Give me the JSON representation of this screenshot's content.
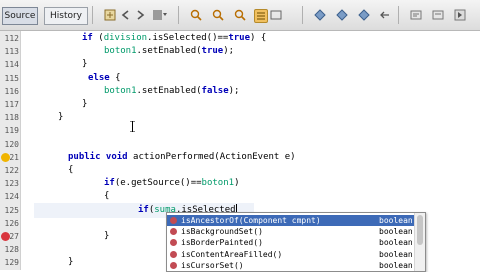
{
  "toolbar": {
    "tab_source": "Source",
    "tab_history": "History"
  },
  "editor": {
    "lines": [
      {
        "num": "112",
        "parts": [
          [
            "kw",
            "if"
          ],
          [
            "t",
            " ("
          ],
          [
            "cls",
            "division"
          ],
          [
            "t",
            ".isSelected()=="
          ],
          [
            "lit",
            "true"
          ],
          [
            "t",
            ") {"
          ]
        ],
        "indent": 82
      },
      {
        "num": "113",
        "parts": [
          [
            "cls",
            "boton1"
          ],
          [
            "t",
            ".setEnabled("
          ],
          [
            "lit",
            "true"
          ],
          [
            "t",
            ");"
          ]
        ],
        "indent": 104
      },
      {
        "num": "114",
        "parts": [
          [
            "t",
            "}"
          ]
        ],
        "indent": 82
      },
      {
        "num": "115",
        "parts": [
          [
            "kw",
            "else"
          ],
          [
            "t",
            " {"
          ]
        ],
        "indent": 88
      },
      {
        "num": "116",
        "parts": [
          [
            "cls",
            "boton1"
          ],
          [
            "t",
            ".setEnabled("
          ],
          [
            "lit",
            "false"
          ],
          [
            "t",
            ");"
          ]
        ],
        "indent": 104
      },
      {
        "num": "117",
        "parts": [
          [
            "t",
            "}"
          ]
        ],
        "indent": 82
      },
      {
        "num": "118",
        "parts": [
          [
            "t",
            "}"
          ]
        ],
        "indent": 58
      },
      {
        "num": "119",
        "parts": [],
        "indent": 58
      },
      {
        "num": "120",
        "parts": [],
        "indent": 58
      },
      {
        "num": "121",
        "parts": [
          [
            "kw",
            "public void "
          ],
          [
            "t",
            "actionPerformed(ActionEvent e)"
          ]
        ],
        "indent": 68
      },
      {
        "num": "122",
        "parts": [
          [
            "t",
            "{"
          ]
        ],
        "indent": 68
      },
      {
        "num": "123",
        "parts": [
          [
            "kw",
            "if"
          ],
          [
            "t",
            "(e.getSource()=="
          ],
          [
            "cls",
            "boton1"
          ],
          [
            "t",
            ")"
          ]
        ],
        "indent": 104
      },
      {
        "num": "124",
        "parts": [
          [
            "t",
            "{"
          ]
        ],
        "indent": 104
      },
      {
        "num": "125",
        "parts": [
          [
            "kw",
            "if"
          ],
          [
            "t",
            "("
          ],
          [
            "cls",
            "suma"
          ],
          [
            "t",
            ".isSelected"
          ]
        ],
        "indent": 138
      },
      {
        "num": "126",
        "parts": [],
        "indent": 58
      },
      {
        "num": "127",
        "parts": [
          [
            "t",
            "}"
          ]
        ],
        "indent": 104
      },
      {
        "num": "128",
        "parts": [],
        "indent": 58
      },
      {
        "num": "129",
        "parts": [
          [
            "t",
            "}"
          ]
        ],
        "indent": 68
      }
    ]
  },
  "autocomplete": {
    "items": [
      {
        "name": "isAncestorOf(Component cmpnt)",
        "type": "boolean",
        "selected": true
      },
      {
        "name": "isBackgroundSet()",
        "type": "boolean",
        "selected": false
      },
      {
        "name": "isBorderPainted()",
        "type": "boolean",
        "selected": false
      },
      {
        "name": "isContentAreaFilled()",
        "type": "boolean",
        "selected": false
      },
      {
        "name": "isCursorSet()",
        "type": "boolean",
        "selected": false
      }
    ]
  },
  "colors": {
    "keyword": "#0000b8",
    "field": "#009a6a",
    "selection": "#3d6ab7",
    "error_marker": "#d9363e"
  }
}
